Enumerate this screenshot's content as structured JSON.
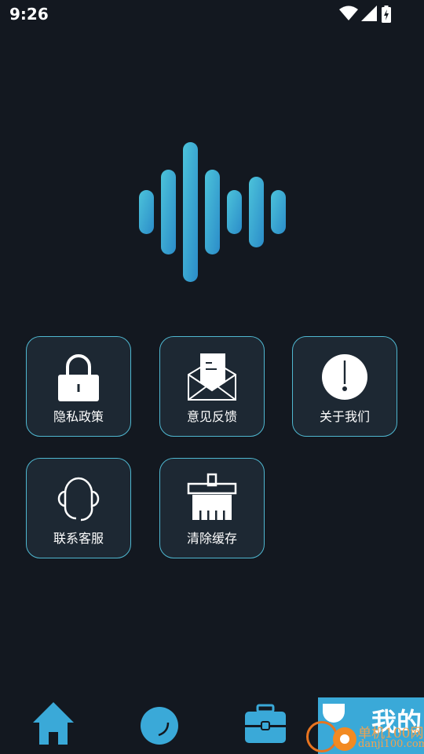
{
  "status_bar": {
    "time": "9:26"
  },
  "menu": [
    {
      "id": "privacy",
      "label": "隐私政策",
      "icon": "lock-icon"
    },
    {
      "id": "feedback",
      "label": "意见反馈",
      "icon": "mail-icon"
    },
    {
      "id": "about",
      "label": "关于我们",
      "icon": "info-icon"
    },
    {
      "id": "support",
      "label": "联系客服",
      "icon": "headset-icon"
    },
    {
      "id": "cache",
      "label": "清除缓存",
      "icon": "broom-icon"
    }
  ],
  "bottom_nav": {
    "mine_label": "我的"
  },
  "watermark": {
    "site_name": "单机100网",
    "site_url": "danji100.com"
  },
  "colors": {
    "accent": "#4fb7d0",
    "background": "#131820",
    "card": "#1d2833"
  }
}
